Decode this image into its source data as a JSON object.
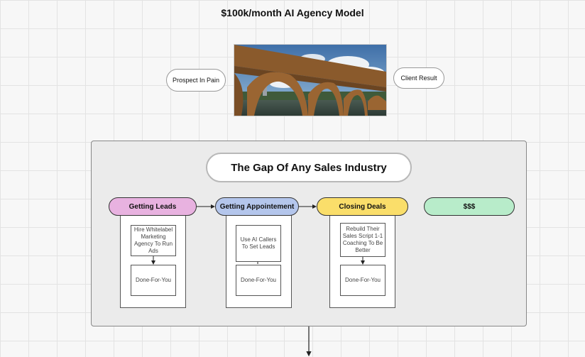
{
  "title": "$100k/month AI Agency Model",
  "prospect_label": "Prospect In Pain",
  "result_label": "Client Result",
  "gap_title": "The Gap Of Any Sales Industry",
  "colors": {
    "leads": "#e8b2e0",
    "appointment": "#b4c6ec",
    "closing": "#fade6a",
    "money": "#b8ecca"
  },
  "stages": {
    "leads": {
      "label": "Getting Leads",
      "step1": "Hire Whitelabel Marketing Agency To Run Ads",
      "step2": "Done-For-You"
    },
    "appointment": {
      "label": "Getting Appointement",
      "step1": "Use AI Callers To Set Leads",
      "step2": "Done-For-You"
    },
    "closing": {
      "label": "Closing Deals",
      "step1": "Rebuild Their Sales Script 1-1 Coaching To Be Better",
      "step2": "Done-For-You"
    },
    "money": {
      "label": "$$$"
    }
  }
}
